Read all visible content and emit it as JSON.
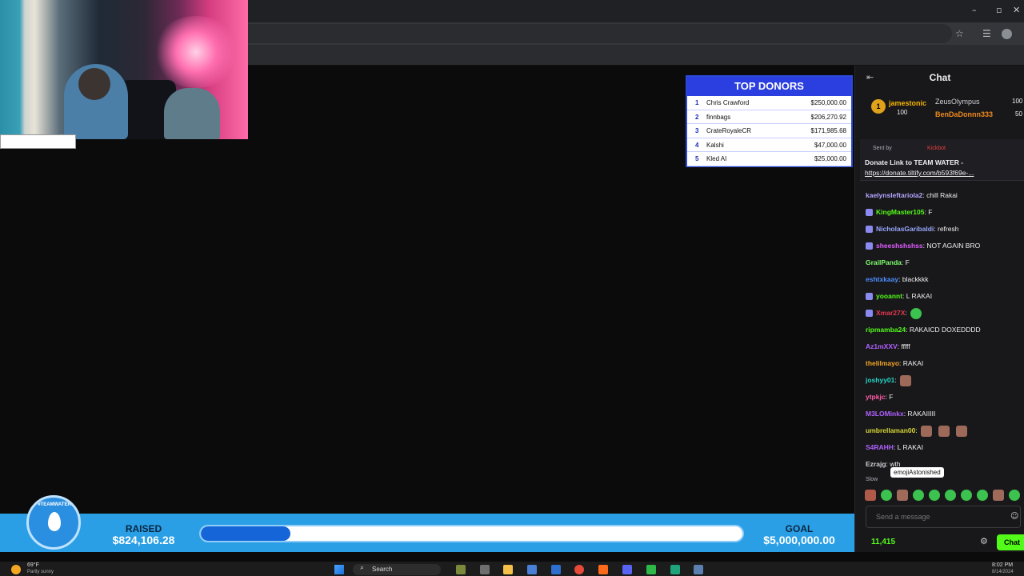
{
  "donors": {
    "title": "TOP DONORS",
    "rows": [
      {
        "rank": "1",
        "name": "Chris Crawford",
        "amount": "$250,000.00"
      },
      {
        "rank": "2",
        "name": "finnbags",
        "amount": "$206,270.92"
      },
      {
        "rank": "3",
        "name": "CrateRoyaleCR",
        "amount": "$171,985.68"
      },
      {
        "rank": "4",
        "name": "Kalshi",
        "amount": "$47,000.00"
      },
      {
        "rank": "5",
        "name": "Kled AI",
        "amount": "$25,000.00"
      }
    ]
  },
  "fundraiser": {
    "raised_label": "RAISED",
    "raised_value": "$824,106.28",
    "goal_label": "GOAL",
    "goal_value": "$5,000,000.00",
    "progress_fraction": 0.165,
    "logo_text": "#TEAMWATER"
  },
  "chat": {
    "title": "Chat",
    "leaderboard": {
      "first_rank": "1",
      "first_name": "jamestonic",
      "first_points": "100",
      "second_name": "ZeusOlympus",
      "second_points": "100",
      "third_name": "BenDaDonnn333",
      "third_points": "50"
    },
    "pinned": {
      "sent_by": "Sent by",
      "sender": "Kickbot",
      "title": "Donate Link to TEAM WATER -",
      "link": "https://donate.tiltify.com/b593f69e-..."
    },
    "messages": [
      {
        "user": "kaelynsleftariola2",
        "text": ": chill Rakai",
        "color": "#b4a7ff"
      },
      {
        "user": "KingMaster105",
        "text": ": F",
        "color": "#53fc18"
      },
      {
        "user": "NicholasGaribaldi",
        "text": ": refresh",
        "color": "#9aa7ff"
      },
      {
        "user": "sheeshshshss",
        "text": ": NOT AGAIN BRO",
        "color": "#e05cff"
      },
      {
        "user": "GrailPanda",
        "text": ": F",
        "color": "#7dff6b"
      },
      {
        "user": "eshtxkaay",
        "text": ": blackkkk",
        "color": "#4d8dff"
      },
      {
        "user": "yooannt",
        "text": ": L RAKAI",
        "color": "#53fc18"
      },
      {
        "user": "Xmar27X",
        "text": ":",
        "color": "#e8384f"
      },
      {
        "user": "ripmamba24",
        "text": ": RAKAICD DOXEDDDD",
        "color": "#53fc18"
      },
      {
        "user": "Az1mXXV",
        "text": ": fffff",
        "color": "#b060ff"
      },
      {
        "user": "thelilmayo",
        "text": ": RAKAI",
        "color": "#f5a623"
      },
      {
        "user": "joshyy01",
        "text": ":",
        "color": "#24d6c7"
      },
      {
        "user": "ytpkjc",
        "text": ": F",
        "color": "#ff5ca8"
      },
      {
        "user": "M3LOMinkx",
        "text": ": RAKAIIIII",
        "color": "#b060ff"
      },
      {
        "user": "umbrellaman00",
        "text": ":",
        "color": "#d6d633"
      },
      {
        "user": "S4RAHH",
        "text": ": L RAKAI",
        "color": "#b060ff"
      },
      {
        "user": "Ezrajg",
        "text": ": wth",
        "color": "#cfcfd4"
      }
    ],
    "slow_mode": "Slow",
    "tooltip": "emojiAstonished",
    "input_placeholder": "Send a message",
    "points": "11,415",
    "chat_button": "Chat"
  },
  "taskbar": {
    "weather_temp": "69°F",
    "weather_desc": "Partly sunny",
    "search_label": "Search",
    "time": "8:02 PM",
    "date": "8/14/2024"
  },
  "colors": {
    "fund_blue": "#2a9fe6",
    "progress_fill": "#1565d8",
    "kick_green": "#53fc18",
    "donor_header": "#2b3ee0"
  }
}
